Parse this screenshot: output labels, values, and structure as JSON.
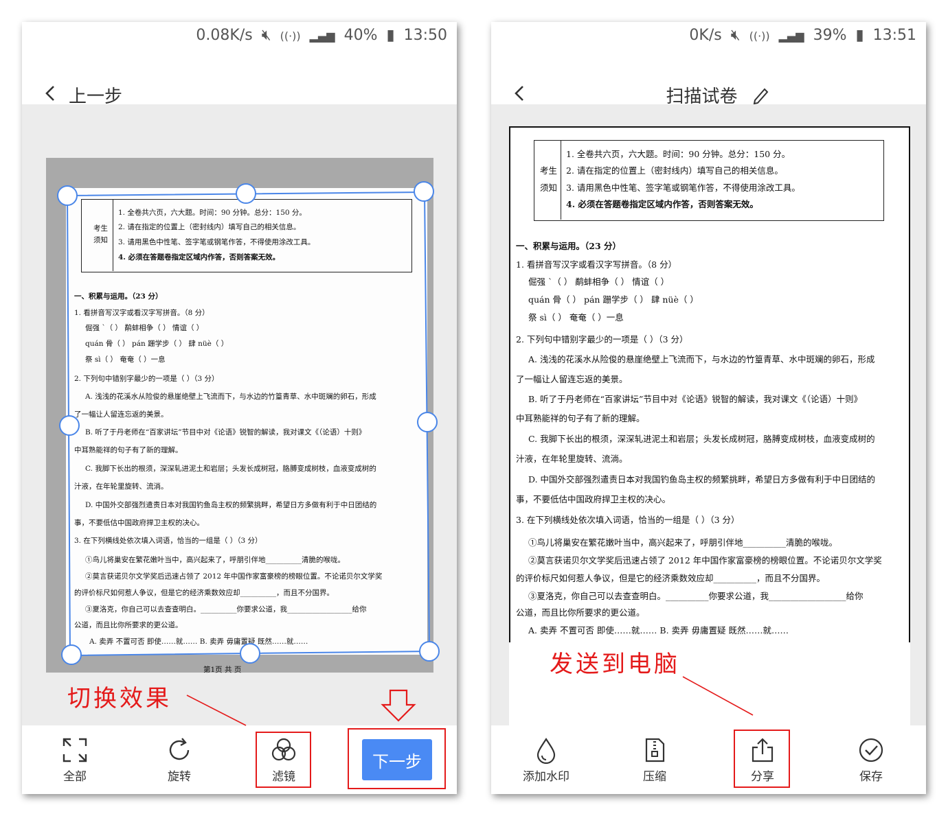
{
  "left": {
    "status": {
      "speed": "0.08K/s",
      "battery": "40%",
      "time": "13:50"
    },
    "header": {
      "back_label": "上一步"
    },
    "toolbar": {
      "fullscreen": "全部",
      "rotate": "旋转",
      "filter": "滤镜",
      "next": "下一步"
    },
    "footer_page": "第1页  共  页"
  },
  "right": {
    "status": {
      "speed": "0K/s",
      "battery": "39%",
      "time": "13:51"
    },
    "header": {
      "title": "扫描试卷"
    },
    "toolbar": {
      "watermark": "添加水印",
      "compress": "压缩",
      "share": "分享",
      "save": "保存"
    }
  },
  "annotations": {
    "switch_effect": "切换效果",
    "send_to_pc": "发送到电脑"
  },
  "doc": {
    "notice_label_1": "考生",
    "notice_label_2": "须知",
    "notice": [
      "1. 全卷共六页，六大题。时间：90 分钟。总分：150 分。",
      "2. 请在指定的位置上（密封线内）填写自己的相关信息。",
      "3. 请用黑色中性笔、签字笔或钢笔作答，不得使用涂改工具。",
      "4. 必须在答题卷指定区域内作答，否则答案无效。"
    ],
    "sec1": "一、积累与运用。（23 分）",
    "q1": "1.  看拼音写汉字或看汉字写拼音。（8 分）",
    "q1_r1": "倔强    ˋ（      ）   鹬蚌相争（      ）   情谊（      ）",
    "q1_r2": "quán 骨（      ） pán 跚学步（      ）   肆 nüè（      ）",
    "q1_r3": "祭 sì（      ）      奄奄（      ）一息",
    "q2": "2.  下列句中错别字最少的一项是（      ）（3 分）",
    "q2_a1": "A. 浅浅的花溪水从险俊的悬崖绝壁上飞流而下，与水边的竹篁青草、水中斑斓的卵石，形成",
    "q2_a2": "了一幅让人留连忘返的美景。",
    "q2_b1": "B. 听了于丹老师在“百家讲坛”节目中对《论语》锐智的解读，我对课文《（论语）十则》",
    "q2_b2": "中耳熟能祥的句子有了新的理解。",
    "q2_c1": "C. 我脚下长出的根须，深深轧进泥土和岩层；头发长成树冠，胳膊变成树枝，血液变成树的",
    "q2_c2": "汁液，在年轮里旋转、流淌。",
    "q2_d1": "D. 中国外交部强烈遣责日本对我国钓鱼岛主权的频繁挑畔，希望日方多做有利于中日团结的",
    "q2_d2": "事，不要低估中国政府捍卫主权的决心。",
    "q3": "3.  在下列横线处依次填入词语，恰当的一组是（      ）（3 分）",
    "q3_1": "①鸟儿将巢安在繁花嫩叶当中，高兴起来了，呼朋引伴地__________清脆的喉咙。",
    "q3_2a": "②莫言获诺贝尔文学奖后迅速占领了 2012 年中国作家富豪榜的榜眼位置。不论诺贝尔文学奖",
    "q3_2b": "的评价标尺如何惹人争议，但是它的经济乘数效应却__________，而且不分国界。",
    "q3_3a": "③夏洛克，你自己可以去查查明白。__________你要求公道，我__________________给你",
    "q3_3b": "公道，而且比你所要求的更公道。",
    "q3_ab": "A. 卖弄    不置可否     即使……就……           B. 卖弄    毋庸置疑     既然……就……"
  }
}
